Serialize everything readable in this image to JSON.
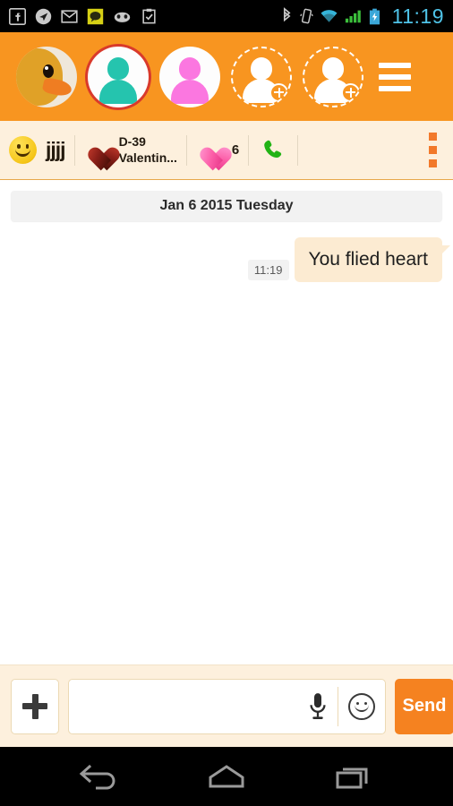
{
  "status_bar": {
    "time": "11:19",
    "left_icons": [
      "facebook-icon",
      "navigation-arrow-icon",
      "gmail-icon",
      "kakaotalk-icon",
      "android-face-icon",
      "clipboard-check-icon"
    ],
    "right_icons": [
      "bluetooth-icon",
      "vibrate-icon",
      "wifi-icon",
      "signal-icon",
      "battery-charging-icon"
    ],
    "clock_color": "#4fc3e8"
  },
  "header": {
    "background_color": "#f89520",
    "avatars": [
      {
        "name": "duck-photo-avatar",
        "type": "photo",
        "selected": false
      },
      {
        "name": "teal-person-avatar",
        "type": "person",
        "color": "#25c4ae",
        "selected": true
      },
      {
        "name": "pink-person-avatar",
        "type": "person",
        "color": "#fb77e0",
        "selected": false
      },
      {
        "name": "add-person-slot-1",
        "type": "add",
        "selected": false
      },
      {
        "name": "add-person-slot-2",
        "type": "add",
        "selected": false
      }
    ],
    "menu_icon": "hamburger-menu-icon"
  },
  "toolbar": {
    "background_color": "#fdf0dd",
    "border_color": "#e8a84b",
    "smiley_icon": "smiley-face-icon",
    "nickname": "jjjj",
    "gift": {
      "icon": "dark-heart-icon",
      "title": "D-39",
      "subtitle": "Valentin...",
      "color": "#8b1f18"
    },
    "hearts": {
      "icon": "pink-heart-icon",
      "count": "6",
      "color": "#fc5fa8"
    },
    "call_icon": "phone-call-icon",
    "call_color": "#22b315",
    "overflow_icon": "overflow-menu-icon",
    "overflow_color": "#f2792a"
  },
  "chat": {
    "background_color": "#ffffff",
    "date_divider": "Jan 6 2015 Tuesday",
    "messages": [
      {
        "text": "You flied heart",
        "time": "11:19",
        "side": "right",
        "bubble_color": "#fcebd2"
      }
    ]
  },
  "input_bar": {
    "background_color": "#fdf0dd",
    "attach_icon": "plus-icon",
    "message_value": "",
    "message_placeholder": "",
    "mic_icon": "microphone-icon",
    "emoji_icon": "smiley-outline-icon",
    "send_label": "Send",
    "send_color": "#f58220"
  },
  "nav_bar": {
    "background_color": "#000000",
    "buttons": [
      "back-icon",
      "home-icon",
      "recents-icon"
    ]
  }
}
